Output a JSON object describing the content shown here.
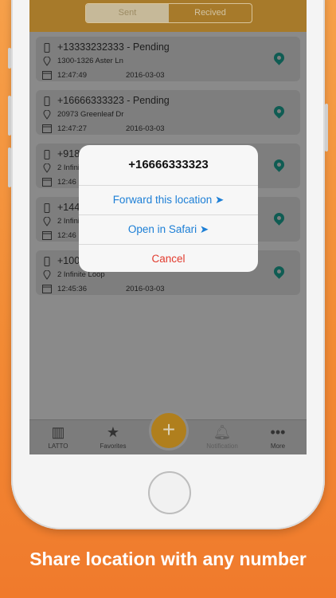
{
  "segment": {
    "sent": "Sent",
    "received": "Recived"
  },
  "items": [
    {
      "number": "+13333232333 - Pending",
      "address": "1300-1326 Aster Ln",
      "time": "12:47:49",
      "date": "2016-03-03"
    },
    {
      "number": "+16666333323 - Pending",
      "address": "20973 Greenleaf Dr",
      "time": "12:47:27",
      "date": "2016-03-03"
    },
    {
      "number": "+918",
      "address": "2 Infini",
      "time": "12:46",
      "date": ""
    },
    {
      "number": "+144",
      "address": "2 Infini",
      "time": "12:46",
      "date": ""
    },
    {
      "number": "+100",
      "address": "2 Infinite Loop",
      "time": "12:45:36",
      "date": "2016-03-03"
    }
  ],
  "dialog": {
    "title": "+16666333323",
    "forward": "Forward this location ➤",
    "safari": "Open in Safari ➤",
    "cancel": "Cancel"
  },
  "tabs": {
    "latto": "LATTO",
    "favorites": "Favorites",
    "notification": "Notification",
    "more": "More"
  },
  "caption": "Share location with any number"
}
